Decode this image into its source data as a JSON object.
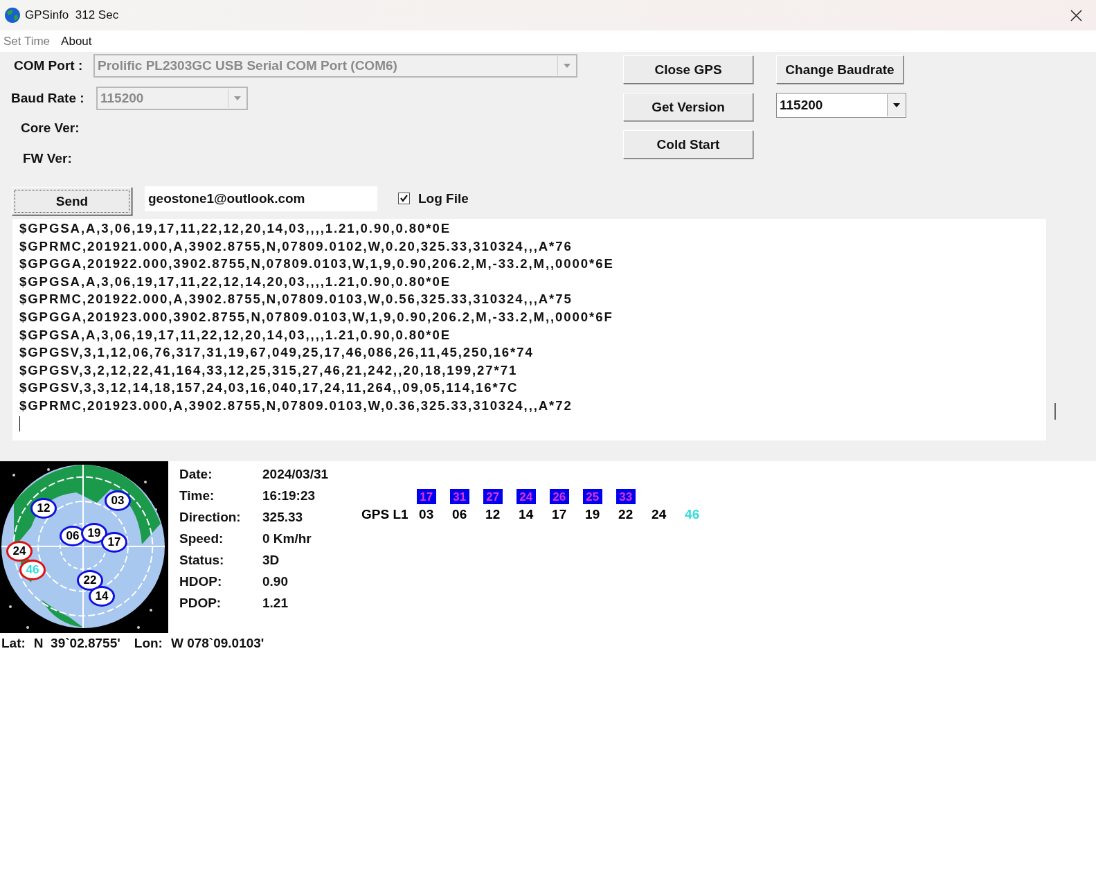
{
  "window": {
    "title": "GPSinfo  312 Sec"
  },
  "menu": [
    {
      "label": "Set Time",
      "disabled": true
    },
    {
      "label": "About",
      "disabled": false
    }
  ],
  "com_port": {
    "label": "COM Port :",
    "value": "Prolific PL2303GC USB Serial COM Port (COM6)",
    "disabled": true
  },
  "baud_rate": {
    "label": "Baud Rate :",
    "value": "115200",
    "disabled": true
  },
  "core_ver": {
    "label": "Core Ver:"
  },
  "fw_ver": {
    "label": "FW Ver:"
  },
  "buttons": [
    {
      "label": "Close GPS"
    },
    {
      "label": "Get Version"
    },
    {
      "label": "Cold Start"
    }
  ],
  "change_baudrate": {
    "label": "Change Baudrate"
  },
  "baud_select": {
    "value": "115200"
  },
  "send": {
    "label": "Send",
    "focused": true
  },
  "email": {
    "value": "geostone1@outlook.com"
  },
  "log_file": {
    "label": "Log File",
    "checked": true
  },
  "log": {
    "lines": [
      "$GPGSA,A,3,06,19,17,11,22,12,20,14,03,,,,1.21,0.90,0.80*0E",
      "$GPRMC,201921.000,A,3902.8755,N,07809.0102,W,0.20,325.33,310324,,,A*76",
      "$GPGGA,201922.000,3902.8755,N,07809.0103,W,1,9,0.90,206.2,M,-33.2,M,,0000*6E",
      "$GPGSA,A,3,06,19,17,11,22,12,14,20,03,,,,1.21,0.90,0.80*0E",
      "$GPRMC,201922.000,A,3902.8755,N,07809.0103,W,0.56,325.33,310324,,,A*75",
      "$GPGGA,201923.000,3902.8755,N,07809.0103,W,1,9,0.90,206.2,M,-33.2,M,,0000*6F",
      "$GPGSA,A,3,06,19,17,11,22,12,20,14,03,,,,1.21,0.90,0.80*0E",
      "$GPGSV,3,1,12,06,76,317,31,19,67,049,25,17,46,086,26,11,45,250,16*74",
      "$GPGSV,3,2,12,22,41,164,33,12,25,315,27,46,21,242,,20,18,199,27*71",
      "$GPGSV,3,3,12,14,18,157,24,03,16,040,17,24,11,264,,09,05,114,16*7C",
      "$GPRMC,201923.000,A,3902.8755,N,07809.0103,W,0.36,325.33,310324,,,A*72"
    ]
  },
  "info": [
    {
      "label": "Date:",
      "value": "2024/03/31"
    },
    {
      "label": "Time:",
      "value": "16:19:23"
    },
    {
      "label": "Direction:",
      "value": "325.33"
    },
    {
      "label": "Speed:",
      "value": "0 Km/hr"
    },
    {
      "label": "Status:",
      "value": "3D"
    },
    {
      "label": "HDOP:",
      "value": "0.90"
    },
    {
      "label": "PDOP:",
      "value": "1.21"
    }
  ],
  "signal": {
    "system": "GPS L1",
    "satellites": [
      {
        "prn": "03",
        "snr": "17",
        "color": "#000000"
      },
      {
        "prn": "06",
        "snr": "31",
        "color": "#000000"
      },
      {
        "prn": "12",
        "snr": "27",
        "color": "#000000"
      },
      {
        "prn": "14",
        "snr": "24",
        "color": "#000000"
      },
      {
        "prn": "17",
        "snr": "26",
        "color": "#000000"
      },
      {
        "prn": "19",
        "snr": "25",
        "color": "#000000"
      },
      {
        "prn": "22",
        "snr": "33",
        "color": "#000000"
      },
      {
        "prn": "24",
        "color": "#000000"
      },
      {
        "prn": "46",
        "color": "#33dddd"
      }
    ]
  },
  "sky": {
    "satellites": [
      {
        "prn": "12",
        "used": true,
        "color": "#000000"
      },
      {
        "prn": "03",
        "used": true,
        "color": "#000000"
      },
      {
        "prn": "06",
        "used": true,
        "color": "#000000"
      },
      {
        "prn": "19",
        "used": true,
        "color": "#000000"
      },
      {
        "prn": "17",
        "used": true,
        "color": "#000000"
      },
      {
        "prn": "24",
        "used": false,
        "color": "#000000"
      },
      {
        "prn": "46",
        "used": false,
        "color": "#33dddd"
      },
      {
        "prn": "22",
        "used": true,
        "color": "#000000"
      },
      {
        "prn": "14",
        "used": true,
        "color": "#000000"
      }
    ]
  },
  "position": {
    "lat_label": "Lat:",
    "lat": "N  39`02.8755'",
    "lon_label": "Lon:",
    "lon": "W 078`09.0103'"
  }
}
